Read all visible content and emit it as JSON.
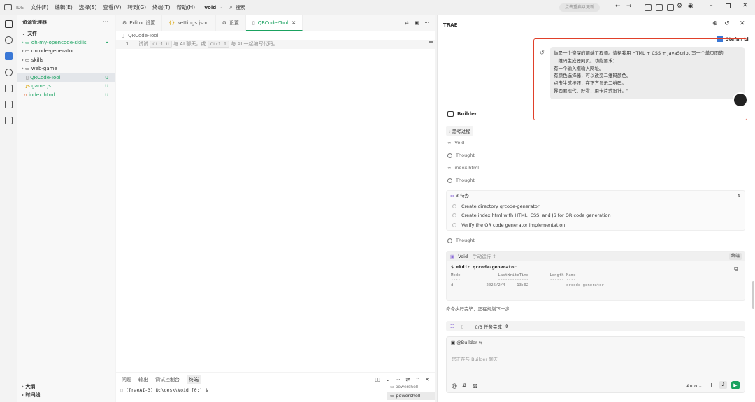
{
  "titlebar": {
    "app_badge": "IDE",
    "menus": [
      "文件(F)",
      "编辑(E)",
      "选择(S)",
      "查看(V)",
      "转到(G)",
      "终端(T)",
      "帮助(H)"
    ],
    "workspace": "Void",
    "search_label": "搜索",
    "update_label": "点击重启以更新"
  },
  "explorer": {
    "title": "资源管理器",
    "section": "文件",
    "items": [
      {
        "label": "oh-my-opencode-skills",
        "badge": "•"
      },
      {
        "label": "qrcode-generator",
        "badge": ""
      },
      {
        "label": "skills",
        "badge": ""
      },
      {
        "label": "web-game",
        "badge": ""
      },
      {
        "label": "QRCode-Tool",
        "badge": "U"
      },
      {
        "label": "game.js",
        "badge": "U"
      },
      {
        "label": "index.html",
        "badge": "U"
      }
    ],
    "outline": "大纲",
    "timeline": "时间线"
  },
  "editor": {
    "tabs": [
      "Editor 设置",
      "settings.json",
      "设置",
      "QRCode-Tool"
    ],
    "breadcrumb": "QRCode-Tool",
    "line_no": "1",
    "hint": {
      "pre": "试试",
      "k1": "Ctrl U",
      "mid1": "与 AI 聊天，或",
      "k2": "Ctrl I",
      "mid2": "与 AI 一起编写代码。"
    }
  },
  "panel": {
    "tabs": [
      "问题",
      "输出",
      "调试控制台",
      "终端"
    ],
    "prompt": "(TraeAI-3) D:\\desk\\Void [0:] $",
    "shells": [
      "powershell",
      "powershell"
    ]
  },
  "chat": {
    "title": "TRAE",
    "user": "Stefan Li",
    "message_lines": [
      "你是一个资深的前端工程师。请帮我用 HTML + CSS + JavaScript 写一个单页面的",
      "二维码生成器网页。功能要求：",
      "有一个输入框输入网址。",
      "有颜色选择器，可以改变二维码颜色。",
      "点击生成按钮，在下方显示二维码。",
      "界面要现代、好看，用卡片式设计。\""
    ],
    "agent": "Builder",
    "thinking": "思考过程",
    "steps": [
      "Void",
      "Thought",
      "index.html",
      "Thought"
    ],
    "todo_title": "3 待办",
    "todos": [
      "Create directory qrcode-generator",
      "Create index.html with HTML, CSS, and JS for QR code generation",
      "Verify the QR code generator implementation"
    ],
    "thought2": "Thought",
    "term": {
      "label": "Void",
      "mode": "手动运行",
      "stop": "终端",
      "cmd": "$ mkdir qrcode-generator",
      "headers": "Mode                LastWriteTime         Length Name",
      "dashes": "----                -------------         ------ ----",
      "row": "d-----         2026/2/4     13:02                qrcode-generator"
    },
    "status": "命令执行完毕，正在规划下一步...",
    "task_progress": "0/3 任务完成",
    "input_agent": "@Builder",
    "placeholder": "您正在与 Builder 聊天",
    "model": "Auto"
  },
  "colors": {
    "accent": "#1aa260",
    "highlight": "#e0402a"
  }
}
